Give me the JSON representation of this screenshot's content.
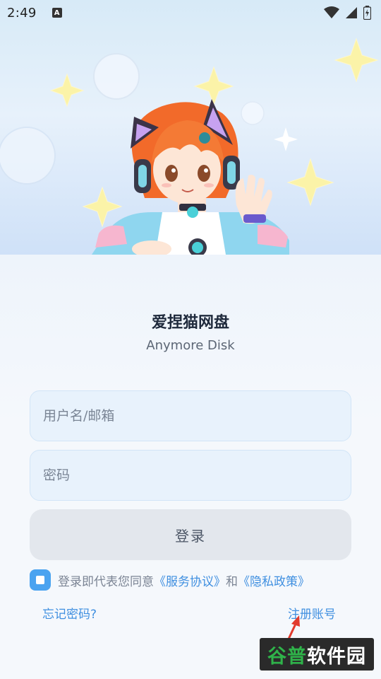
{
  "status": {
    "time": "2:49",
    "a_icon_letter": "A"
  },
  "app": {
    "title": "爱捏猫网盘",
    "subtitle": "Anymore Disk"
  },
  "form": {
    "username_placeholder": "用户名/邮箱",
    "username_value": "",
    "password_placeholder": "密码",
    "password_value": "",
    "login_label": "登录"
  },
  "agreement": {
    "checked": true,
    "prefix": "登录即代表您同意",
    "terms_link": "《服务协议》",
    "and": "和",
    "privacy_link": "《隐私政策》"
  },
  "links": {
    "forgot": "忘记密码?",
    "register": "注册账号"
  },
  "watermark": {
    "green_part": "谷普",
    "white_part": "软件园"
  },
  "colors": {
    "accent": "#3f8fe0",
    "checkbox": "#4aa3f0",
    "input_bg": "#e8f2fc",
    "button_bg": "#e3e7ed"
  }
}
